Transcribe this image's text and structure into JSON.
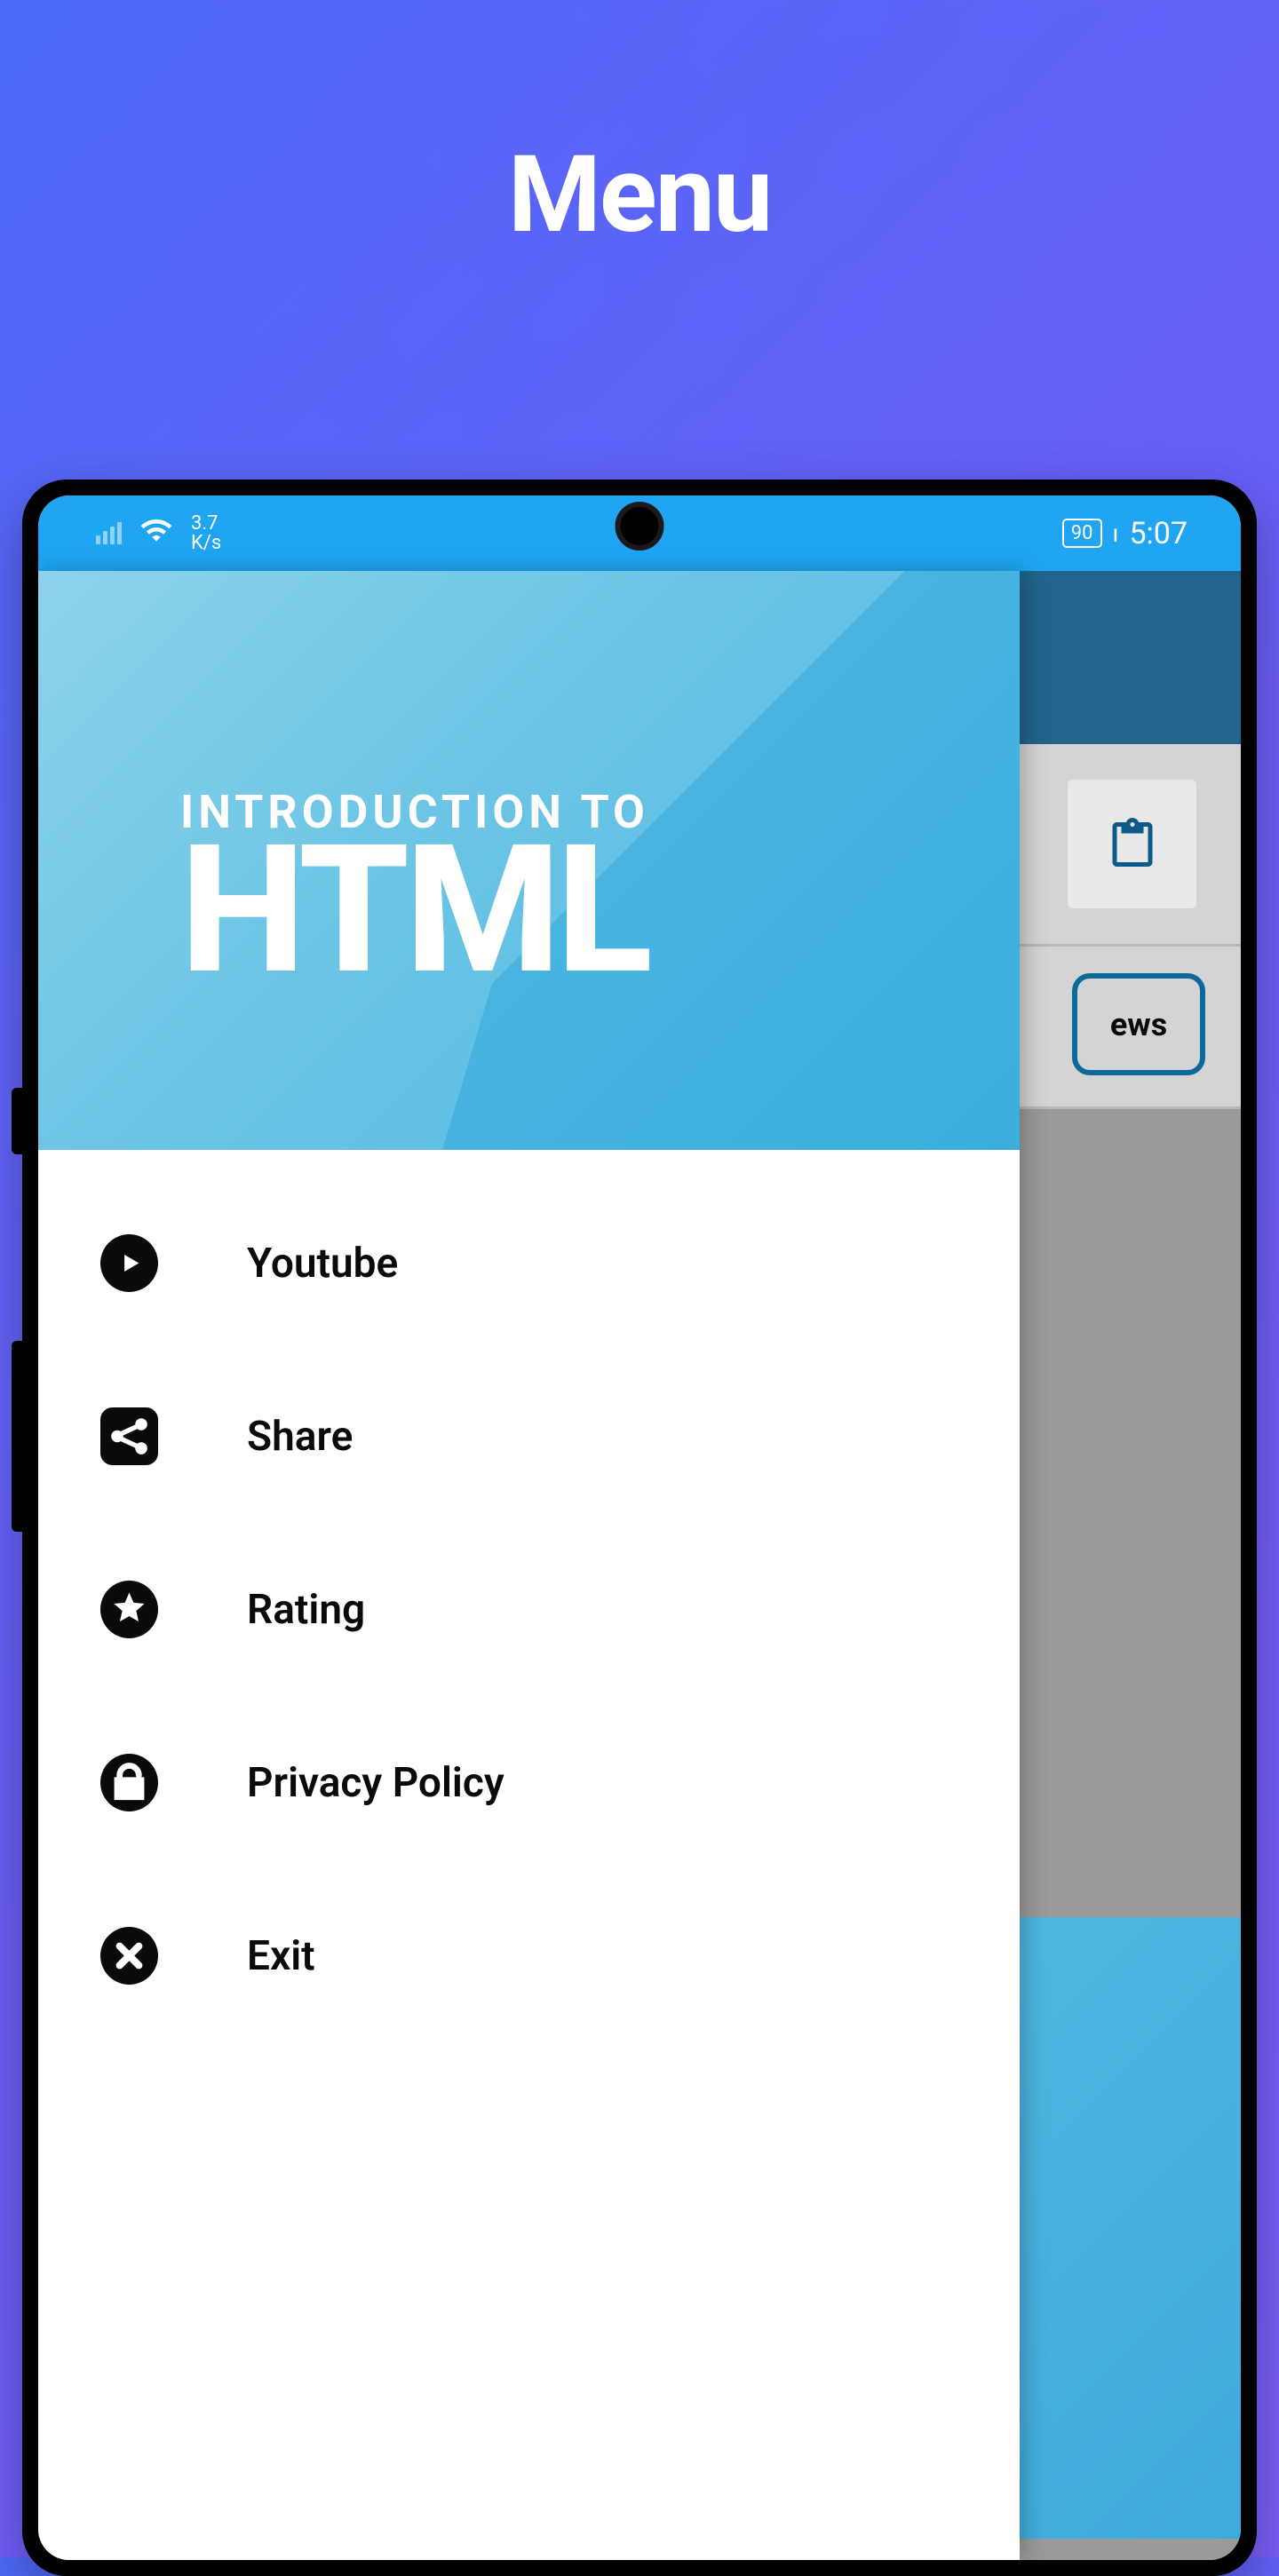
{
  "page": {
    "title": "Menu"
  },
  "status_bar": {
    "speed_value": "3.7",
    "speed_unit": "K/s",
    "battery_pct": "90",
    "time": "5:07"
  },
  "drawer": {
    "header_subtitle": "INTRODUCTION TO",
    "header_title": "HTML",
    "items": [
      {
        "label": "Youtube",
        "icon": "youtube-icon"
      },
      {
        "label": "Share",
        "icon": "share-icon"
      },
      {
        "label": "Rating",
        "icon": "star-icon"
      },
      {
        "label": "Privacy Policy",
        "icon": "lock-icon"
      },
      {
        "label": "Exit",
        "icon": "close-icon"
      }
    ]
  },
  "background": {
    "tab_partial": "ews"
  }
}
